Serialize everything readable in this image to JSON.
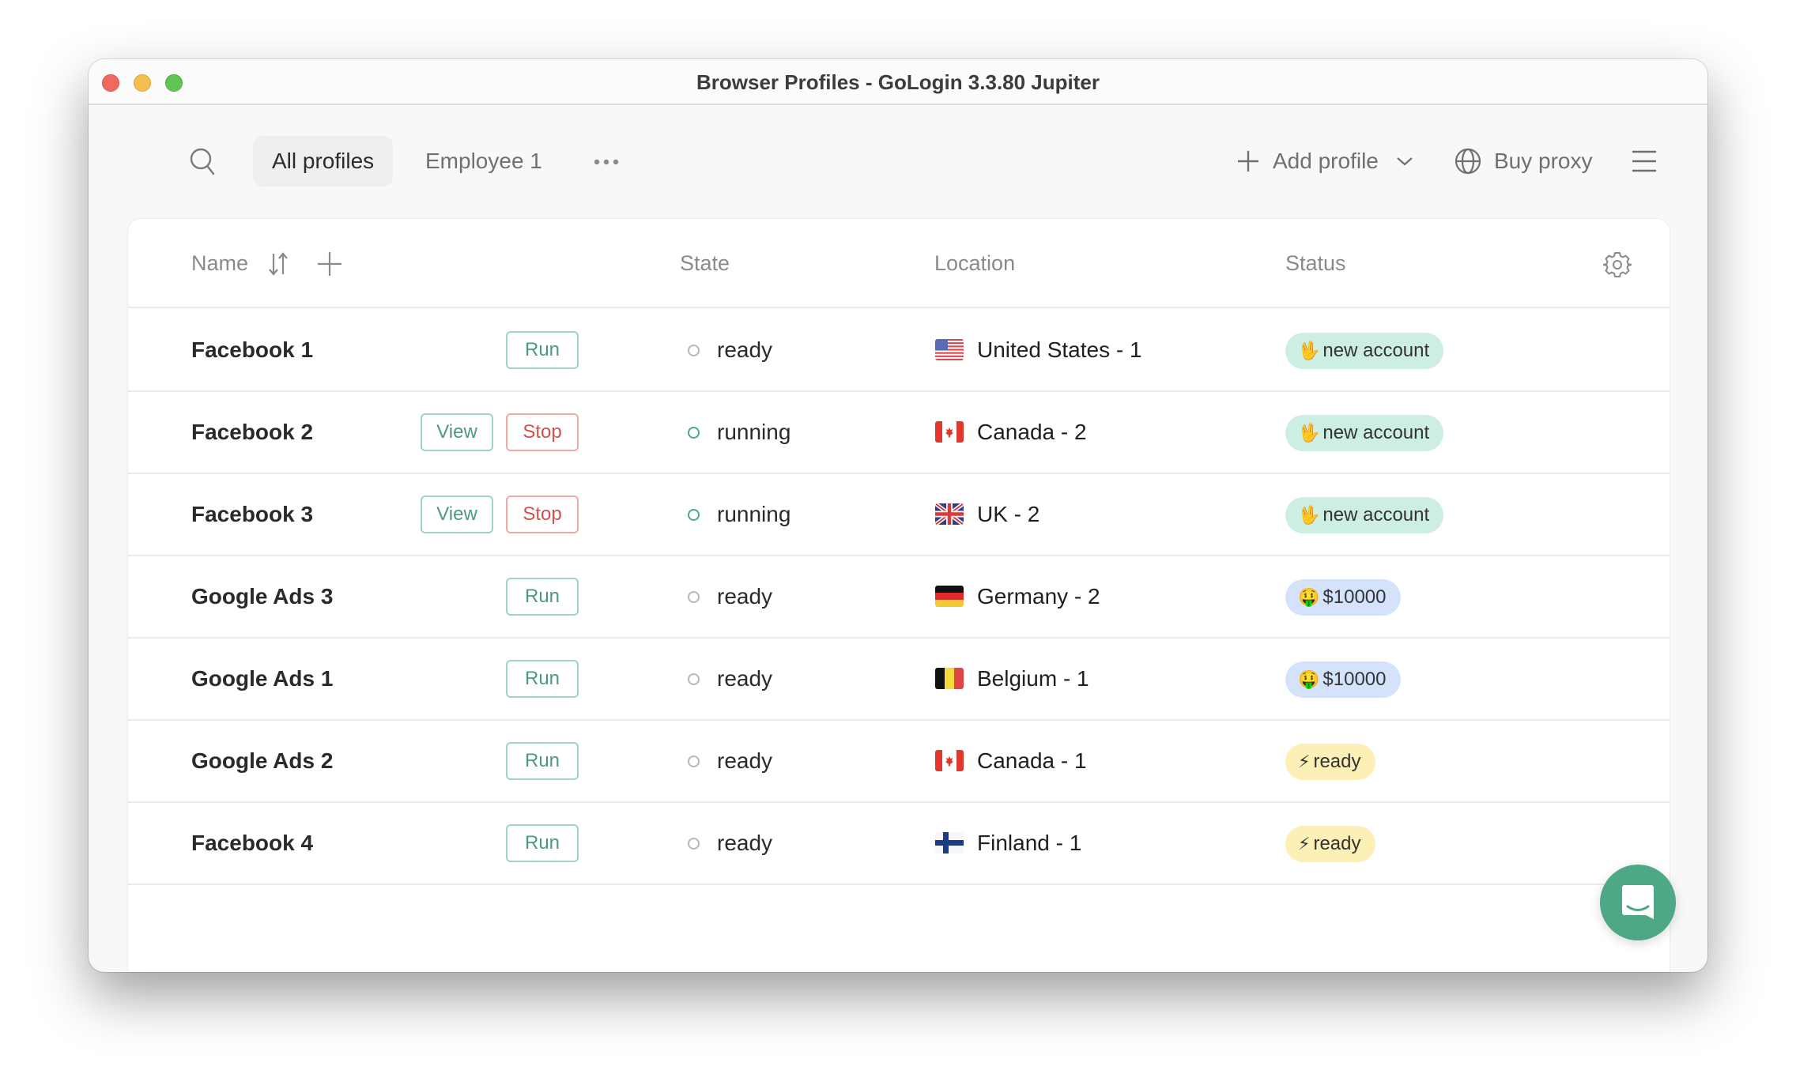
{
  "window": {
    "title": "Browser Profiles - GoLogin 3.3.80 Jupiter"
  },
  "toolbar": {
    "search_icon": "search-icon",
    "tabs": [
      {
        "label": "All profiles",
        "active": true
      },
      {
        "label": "Employee 1",
        "active": false
      }
    ],
    "more_icon": "more-horizontal-icon",
    "add_profile_label": "Add profile",
    "buy_proxy_label": "Buy proxy",
    "menu_icon": "hamburger-menu-icon"
  },
  "table": {
    "columns": {
      "name": "Name",
      "state": "State",
      "location": "Location",
      "status": "Status"
    },
    "rows": [
      {
        "name": "Facebook 1",
        "buttons": [
          "Run"
        ],
        "state": "ready",
        "location": "United States - 1",
        "flag": "us",
        "status": {
          "emoji": "🖖",
          "label": "new account",
          "color": "green"
        }
      },
      {
        "name": "Facebook 2",
        "buttons": [
          "View",
          "Stop"
        ],
        "state": "running",
        "location": "Canada - 2",
        "flag": "ca",
        "status": {
          "emoji": "🖖",
          "label": "new account",
          "color": "green"
        }
      },
      {
        "name": "Facebook 3",
        "buttons": [
          "View",
          "Stop"
        ],
        "state": "running",
        "location": "UK - 2",
        "flag": "gb",
        "status": {
          "emoji": "🖖",
          "label": "new account",
          "color": "green"
        }
      },
      {
        "name": "Google Ads 3",
        "buttons": [
          "Run"
        ],
        "state": "ready",
        "location": "Germany - 2",
        "flag": "de",
        "status": {
          "emoji": "🤑",
          "label": "$10000",
          "color": "blue"
        }
      },
      {
        "name": "Google Ads 1",
        "buttons": [
          "Run"
        ],
        "state": "ready",
        "location": "Belgium - 1",
        "flag": "be",
        "status": {
          "emoji": "🤑",
          "label": "$10000",
          "color": "blue"
        }
      },
      {
        "name": "Google Ads 2",
        "buttons": [
          "Run"
        ],
        "state": "ready",
        "location": "Canada - 1",
        "flag": "ca",
        "status": {
          "emoji": "⚡",
          "label": "ready",
          "color": "yellow"
        }
      },
      {
        "name": "Facebook 4",
        "buttons": [
          "Run"
        ],
        "state": "ready",
        "location": "Finland - 1",
        "flag": "fi",
        "status": {
          "emoji": "⚡",
          "label": "ready",
          "color": "yellow"
        }
      }
    ]
  },
  "colors": {
    "accent": "#4ea886",
    "run_border": "#9fd3c4",
    "stop_text": "#d0504a",
    "badge_green": "#cdeee2",
    "badge_blue": "#d4e3fb",
    "badge_yellow": "#fcf0b7"
  }
}
